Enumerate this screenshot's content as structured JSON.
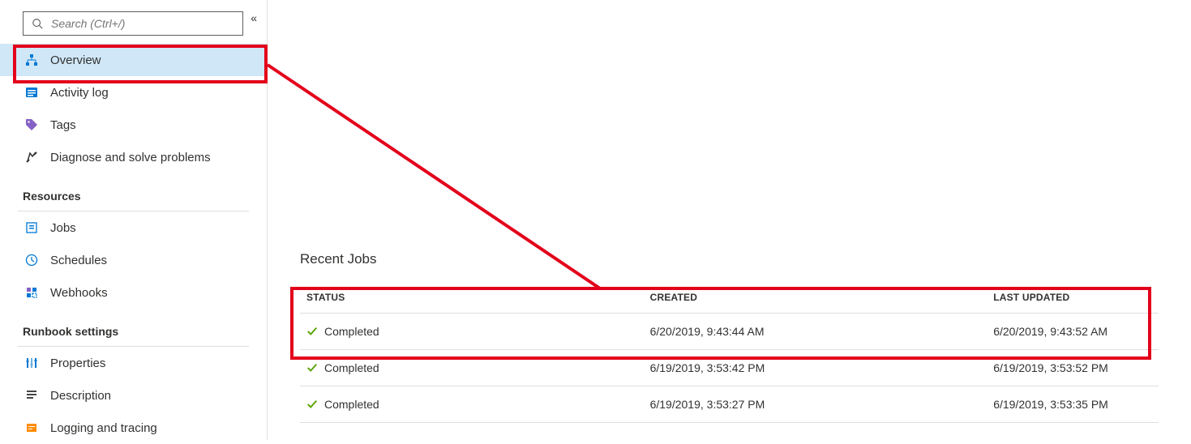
{
  "search": {
    "placeholder": "Search (Ctrl+/)"
  },
  "sidebar": {
    "items": [
      {
        "label": "Overview"
      },
      {
        "label": "Activity log"
      },
      {
        "label": "Tags"
      },
      {
        "label": "Diagnose and solve problems"
      }
    ],
    "sections": [
      {
        "title": "Resources",
        "items": [
          {
            "label": "Jobs"
          },
          {
            "label": "Schedules"
          },
          {
            "label": "Webhooks"
          }
        ]
      },
      {
        "title": "Runbook settings",
        "items": [
          {
            "label": "Properties"
          },
          {
            "label": "Description"
          },
          {
            "label": "Logging and tracing"
          }
        ]
      }
    ]
  },
  "main": {
    "recent_jobs_title": "Recent Jobs",
    "columns": {
      "status": "STATUS",
      "created": "CREATED",
      "updated": "LAST UPDATED"
    },
    "rows": [
      {
        "status": "Completed",
        "created": "6/20/2019, 9:43:44 AM",
        "updated": "6/20/2019, 9:43:52 AM"
      },
      {
        "status": "Completed",
        "created": "6/19/2019, 3:53:42 PM",
        "updated": "6/19/2019, 3:53:52 PM"
      },
      {
        "status": "Completed",
        "created": "6/19/2019, 3:53:27 PM",
        "updated": "6/19/2019, 3:53:35 PM"
      }
    ]
  },
  "colors": {
    "annotation": "#e3001b",
    "selected_bg": "#d0e7f8",
    "success": "#57a300"
  }
}
